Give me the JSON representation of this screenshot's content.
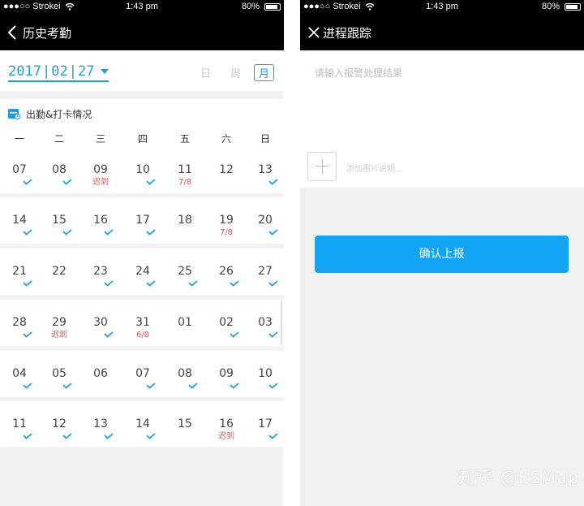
{
  "status": {
    "carrier": "●●●○○ Strokei",
    "time": "1:43 pm",
    "battery": "80%"
  },
  "left": {
    "title": "历史考勤",
    "date": {
      "year": "2017",
      "month": "02",
      "day": "27"
    },
    "view_tabs": [
      "日",
      "周",
      "月"
    ],
    "active_view": "月",
    "section_title": "出勤&打卡情况",
    "weekdays": [
      "一",
      "二",
      "三",
      "四",
      "五",
      "六",
      "日"
    ],
    "weeks": [
      [
        {
          "d": "07",
          "c": true
        },
        {
          "d": "08",
          "c": true
        },
        {
          "d": "09",
          "c": false,
          "n": "迟到"
        },
        {
          "d": "10",
          "c": true
        },
        {
          "d": "11",
          "c": false,
          "n": "7/8"
        },
        {
          "d": "12",
          "c": false
        },
        {
          "d": "13",
          "c": true
        }
      ],
      [
        {
          "d": "14",
          "c": true
        },
        {
          "d": "15",
          "c": true
        },
        {
          "d": "16",
          "c": true
        },
        {
          "d": "17",
          "c": true
        },
        {
          "d": "18",
          "c": false
        },
        {
          "d": "19",
          "c": false,
          "n": "7/8"
        },
        {
          "d": "20",
          "c": true
        }
      ],
      [
        {
          "d": "21",
          "c": true
        },
        {
          "d": "22",
          "c": false
        },
        {
          "d": "23",
          "c": true
        },
        {
          "d": "24",
          "c": true
        },
        {
          "d": "25",
          "c": true
        },
        {
          "d": "26",
          "c": true
        },
        {
          "d": "27",
          "c": true
        }
      ],
      [
        {
          "d": "28",
          "c": true
        },
        {
          "d": "29",
          "c": false,
          "n": "迟到"
        },
        {
          "d": "30",
          "c": true
        },
        {
          "d": "31",
          "c": false,
          "n": "6/8"
        },
        {
          "d": "01",
          "c": false
        },
        {
          "d": "02",
          "c": true
        },
        {
          "d": "03",
          "c": true
        }
      ],
      [
        {
          "d": "04",
          "c": true
        },
        {
          "d": "05",
          "c": true
        },
        {
          "d": "06",
          "c": false
        },
        {
          "d": "07",
          "c": true
        },
        {
          "d": "08",
          "c": true
        },
        {
          "d": "09",
          "c": true
        },
        {
          "d": "10",
          "c": true
        }
      ],
      [
        {
          "d": "11",
          "c": true
        },
        {
          "d": "12",
          "c": true
        },
        {
          "d": "13",
          "c": true
        },
        {
          "d": "14",
          "c": true
        },
        {
          "d": "15",
          "c": false
        },
        {
          "d": "16",
          "c": false,
          "n": "迟到"
        },
        {
          "d": "17",
          "c": true
        }
      ]
    ]
  },
  "right": {
    "title": "进程跟踪",
    "input_placeholder": "请输入报警处理结果",
    "add_image_hint": "添加图片说明...",
    "submit_label": "确认上报"
  },
  "watermark": "知乎 @ESMap",
  "colors": {
    "accent": "#1aa0e0",
    "late": "#e05555",
    "button": "#12a4f5"
  }
}
